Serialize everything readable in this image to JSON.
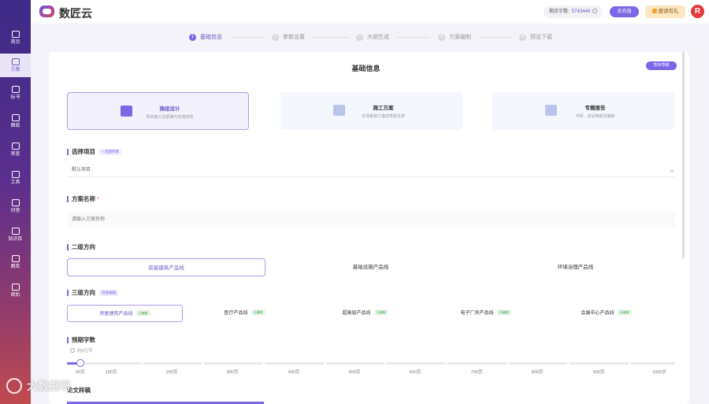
{
  "brand": {
    "name": "数匠云"
  },
  "sidebar": {
    "items": [
      {
        "label": "首页",
        "icon": "home-icon",
        "active": false
      },
      {
        "label": "方案",
        "icon": "document-icon",
        "active": true
      },
      {
        "label": "标书",
        "icon": "bid-icon",
        "active": false
      },
      {
        "label": "图纸",
        "icon": "drawing-icon",
        "active": false
      },
      {
        "label": "审查",
        "icon": "review-icon",
        "active": false
      },
      {
        "label": "工具",
        "icon": "tools-icon",
        "active": false
      },
      {
        "label": "问答",
        "icon": "chat-icon",
        "active": false
      },
      {
        "label": "知识库",
        "icon": "knowledge-icon",
        "active": false
      },
      {
        "label": "图库",
        "icon": "gallery-icon",
        "active": false
      },
      {
        "label": "商机",
        "icon": "opportunity-icon",
        "active": false
      }
    ]
  },
  "topbar": {
    "word_label": "剩余字数:",
    "word_count": "5743448",
    "recharge_label": "去充值",
    "invite_label": "邀请有礼",
    "avatar_letter": "R"
  },
  "stepper": {
    "steps": [
      {
        "num": "1",
        "label": "基础信息",
        "active": true
      },
      {
        "num": "2",
        "label": "参数设置",
        "active": false
      },
      {
        "num": "3",
        "label": "大纲生成",
        "active": false
      },
      {
        "num": "4",
        "label": "方案编制",
        "active": false
      },
      {
        "num": "5",
        "label": "预览下载",
        "active": false
      }
    ]
  },
  "main": {
    "title": "基础信息",
    "draft_button": "暂存草稿",
    "type_cards": [
      {
        "name": "施组设计",
        "desc": "项目施工总部署与实施规则",
        "active": true
      },
      {
        "name": "施工方案",
        "desc": "全场景施工描述类型论表",
        "active": false
      },
      {
        "name": "专题报告",
        "desc": "可研、初设等报告编制",
        "active": false
      }
    ],
    "project_section": {
      "label": "选择项目",
      "tag": "+ 创建项目",
      "value": "默认项目"
    },
    "name_section": {
      "label": "方案名称",
      "required": "*",
      "placeholder": "请输入方案名称"
    },
    "level2": {
      "label": "二级方向",
      "options": [
        {
          "label": "房屋建筑产品线",
          "active": true
        },
        {
          "label": "基础设施产品线",
          "active": false
        },
        {
          "label": "环境治理产品线",
          "active": false
        }
      ]
    },
    "level3": {
      "label": "三级方向",
      "tag": "内容编辑",
      "options": [
        {
          "label": "房屋建筑产品线",
          "tag": "已编辑",
          "active": true
        },
        {
          "label": "医疗产品线",
          "tag": "已编辑",
          "active": false
        },
        {
          "label": "超高层产品线",
          "tag": "已编辑",
          "active": false
        },
        {
          "label": "电子厂房产品线",
          "tag": "已编辑",
          "active": false
        },
        {
          "label": "会展中心产品线",
          "tag": "已编辑",
          "active": false
        }
      ]
    },
    "pages": {
      "label": "预期字数",
      "hint": "约8万字",
      "value": 50,
      "min": 50,
      "max": 1000,
      "ticks": [
        "50页",
        "100页",
        "200页",
        "300页",
        "400页",
        "500页",
        "600页",
        "700页",
        "800页",
        "900页",
        "1000页"
      ]
    },
    "next_section_label": "论文样稿"
  },
  "watermark": {
    "text": "大数据哥"
  },
  "colors": {
    "accent": "#7c66e8",
    "sidebar_top": "#3c2a86",
    "sidebar_bottom": "#c04a4f",
    "tag_green": "#4aa65a"
  }
}
